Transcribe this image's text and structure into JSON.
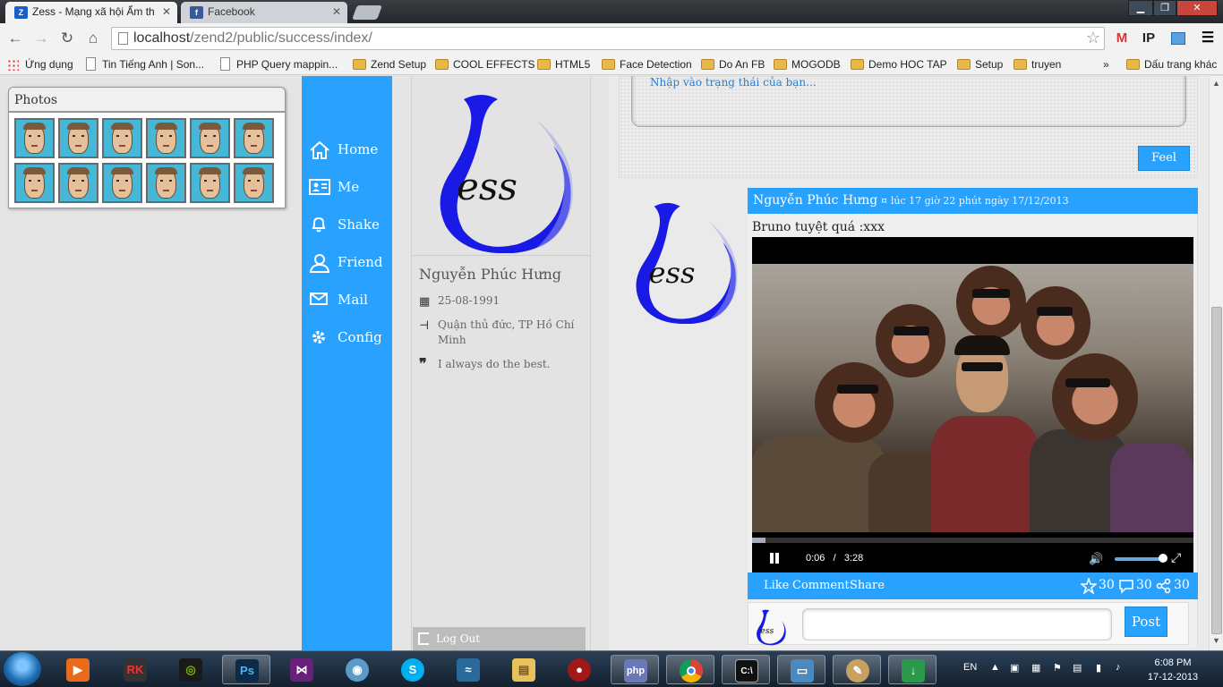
{
  "browser": {
    "tabs": [
      {
        "label": "Zess - Mạng xã hội Ẩm th",
        "icon": "zess-favicon",
        "active": true
      },
      {
        "label": "Facebook",
        "icon": "facebook-favicon",
        "active": false
      }
    ],
    "url_host": "localhost",
    "url_path": "/zend2/public/success/index/",
    "extensions": [
      {
        "icon": "gmail-icon",
        "label": "M"
      },
      {
        "icon": "ip-icon",
        "label": "IP"
      }
    ],
    "bookmarks": [
      {
        "label": "Ứng dụng",
        "type": "apps"
      },
      {
        "label": "Tin Tiếng Anh | Son...",
        "type": "page"
      },
      {
        "label": "PHP Query mappin...",
        "type": "page"
      },
      {
        "label": "Zend Setup",
        "type": "folder"
      },
      {
        "label": "COOL EFFECTS",
        "type": "folder"
      },
      {
        "label": "HTML5",
        "type": "folder"
      },
      {
        "label": "Face Detection",
        "type": "folder"
      },
      {
        "label": "Do An FB",
        "type": "folder"
      },
      {
        "label": "MOGODB",
        "type": "folder"
      },
      {
        "label": "Demo HOC TAP",
        "type": "folder"
      },
      {
        "label": "Setup",
        "type": "folder"
      },
      {
        "label": "truyen",
        "type": "folder"
      },
      {
        "label": "Dấu trang khác",
        "type": "folder"
      }
    ],
    "overflow": "»"
  },
  "photos": {
    "title": "Photos",
    "count": 12
  },
  "nav": {
    "items": [
      {
        "label": "Home",
        "icon": "home-icon"
      },
      {
        "label": "Me",
        "icon": "id-card-icon"
      },
      {
        "label": "Shake",
        "icon": "bell-icon"
      },
      {
        "label": "Friend",
        "icon": "user-icon"
      },
      {
        "label": "Mail",
        "icon": "mail-icon"
      },
      {
        "label": "Config",
        "icon": "gear-icon"
      }
    ]
  },
  "profile": {
    "logo_text": "ess",
    "name": "Nguyễn Phúc Hưng",
    "birthday": "25-08-1991",
    "location": "Quận thủ đức, TP Hồ Chí Minh",
    "quote": "I always do the best.",
    "logout_label": "Log Out"
  },
  "status": {
    "placeholder": "Nhập vào trạng thái của bạn...",
    "button_label": "Feel"
  },
  "post": {
    "author": "Nguyễn Phúc Hưng",
    "separator": "¤",
    "time": "lúc 17 giờ 22 phút ngày 17/12/2013",
    "text": "Bruno tuyệt quá :xxx",
    "video": {
      "current": "0:06",
      "divider": "/",
      "duration": "3:28",
      "progress": 0.03,
      "volume": 0.85
    },
    "actions": {
      "like": "Like",
      "comment": "Comment",
      "share": "Share"
    },
    "counts": {
      "likes": "30",
      "comments": "30",
      "shares": "30"
    },
    "comment_button": "Post"
  },
  "taskbar": {
    "language": "EN",
    "time": "6:08 PM",
    "date": "17-12-2013"
  },
  "colors": {
    "accent": "#29a2ff",
    "logo_blue": "#1a1ae6"
  }
}
